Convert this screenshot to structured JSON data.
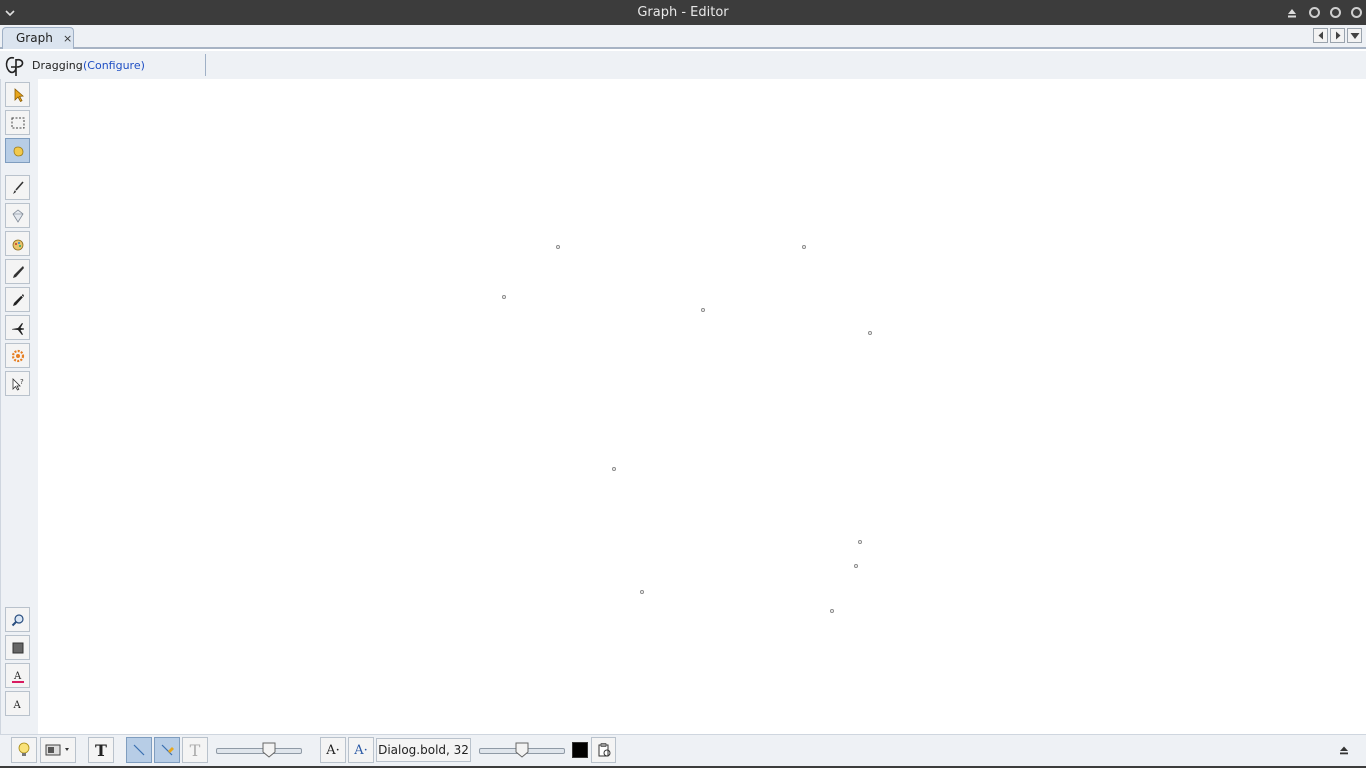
{
  "window": {
    "title": "Graph - Editor"
  },
  "tabs": [
    {
      "label": "Graph",
      "close": "×"
    }
  ],
  "status": {
    "mode": "Dragging",
    "configure_link": "(Configure)"
  },
  "left_tools": [
    {
      "name": "select-tool",
      "icon": "arrow-pointer-icon",
      "active": false
    },
    {
      "name": "rect-select-tool",
      "icon": "dashed-rectangle-icon",
      "active": false
    },
    {
      "name": "drag-tool",
      "icon": "hand-icon",
      "active": true
    },
    {
      "name": "brush-tool",
      "icon": "brush-icon",
      "active": false
    },
    {
      "name": "eraser-tool",
      "icon": "diamond-eraser-icon",
      "active": false
    },
    {
      "name": "paint-tool",
      "icon": "paint-palette-icon",
      "active": false
    },
    {
      "name": "pencil-tool",
      "icon": "pencil-icon",
      "active": false
    },
    {
      "name": "pen-tool",
      "icon": "pen-icon",
      "active": false
    },
    {
      "name": "plane-tool",
      "icon": "airplane-icon",
      "active": false
    },
    {
      "name": "gear-tool",
      "icon": "gear-icon",
      "active": false
    },
    {
      "name": "help-pointer-tool",
      "icon": "help-pointer-icon",
      "active": false
    }
  ],
  "left_tools_bottom": [
    {
      "name": "zoom-tool",
      "icon": "zoom-icon"
    },
    {
      "name": "fill-color-tool",
      "icon": "square-fill-icon"
    },
    {
      "name": "font-color-tool",
      "icon": "text-color-icon"
    },
    {
      "name": "font-tool",
      "icon": "text-font-icon"
    }
  ],
  "bottom": {
    "font_label": "Dialog.bold, 32",
    "text_glyph": "T",
    "font_size_glyph": "A·",
    "text_color_hex": "#000000",
    "slider1_value": 0.7,
    "slider2_value": 0.5
  },
  "colors": {
    "accent": "#b7cde6",
    "link": "#1f4fc4",
    "titlebar": "#3c3c3c"
  }
}
